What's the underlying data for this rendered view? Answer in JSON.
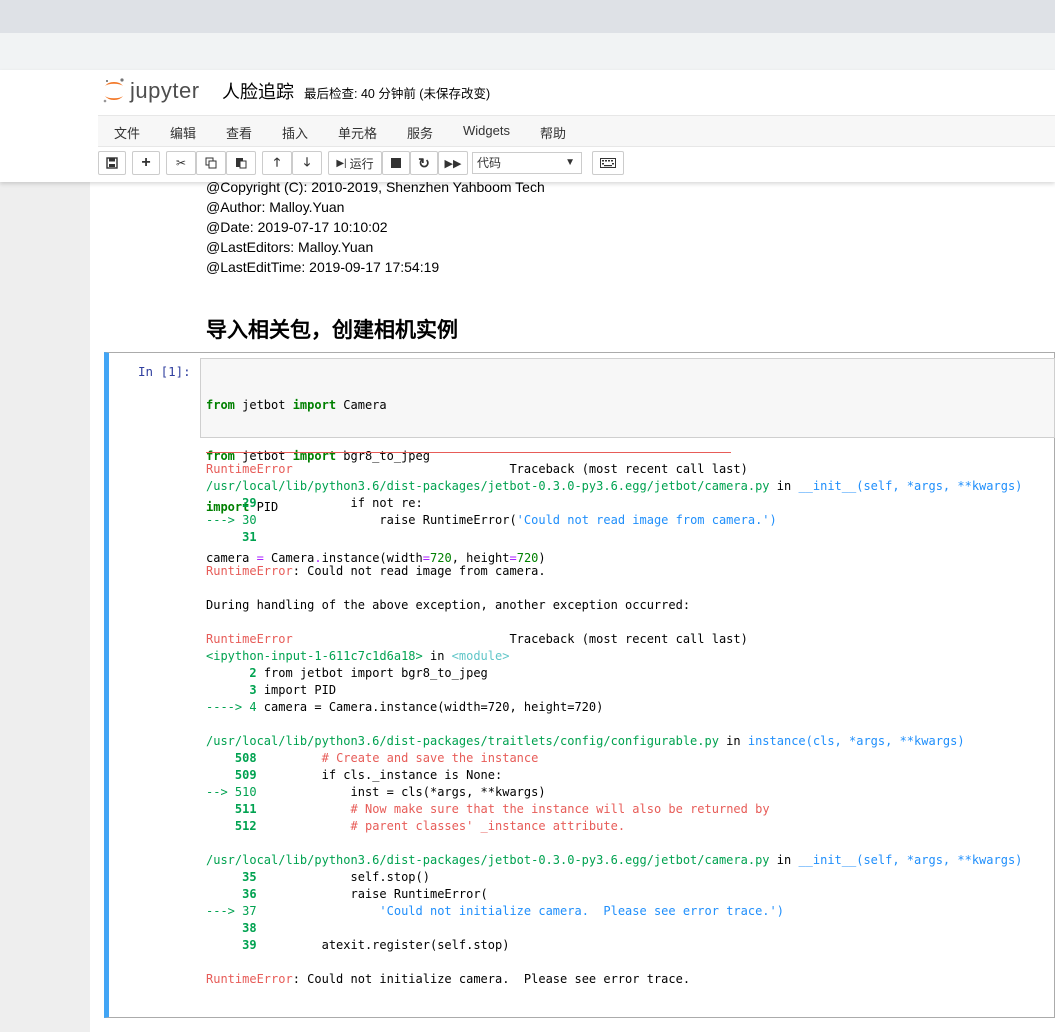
{
  "header": {
    "logo_text": "jupyter",
    "notebook_name": "人脸追踪",
    "checkpoint": "最后检查: 40 分钟前  (未保存改变)"
  },
  "menu": [
    "文件",
    "编辑",
    "查看",
    "插入",
    "单元格",
    "服务",
    "Widgets",
    "帮助"
  ],
  "toolbar": {
    "run_label": "运行",
    "cell_type": "代码"
  },
  "markdown": {
    "lines": [
      "@Copyright (C): 2010-2019, Shenzhen Yahboom Tech",
      "@Author: Malloy.Yuan",
      "@Date: 2019-07-17 10:10:02",
      "@LastEditors: Malloy.Yuan",
      "@LastEditTime: 2019-09-17 17:54:19"
    ],
    "heading": "导入相关包，创建相机实例"
  },
  "cell": {
    "prompt": "In  [1]:",
    "code": [
      "from jetbot import Camera",
      "from jetbot import bgr8_to_jpeg",
      "import PID",
      "camera = Camera.instance(width=720, height=720)"
    ],
    "traceback": [
      "RuntimeError                              Traceback (most recent call last)",
      "/usr/local/lib/python3.6/dist-packages/jetbot-0.3.0-py3.6.egg/jetbot/camera.py in __init__(self, *args, **kwargs)",
      "     29             if not re:",
      "---> 30                 raise RuntimeError('Could not read image from camera.')",
      "     31 ",
      "",
      "RuntimeError: Could not read image from camera.",
      "",
      "During handling of the above exception, another exception occurred:",
      "",
      "RuntimeError                              Traceback (most recent call last)",
      "<ipython-input-1-611c7c1d6a18> in <module>",
      "      2 from jetbot import bgr8_to_jpeg",
      "      3 import PID",
      "----> 4 camera = Camera.instance(width=720, height=720)",
      "",
      "/usr/local/lib/python3.6/dist-packages/traitlets/config/configurable.py in instance(cls, *args, **kwargs)",
      "    508         # Create and save the instance",
      "    509         if cls._instance is None:",
      "--> 510             inst = cls(*args, **kwargs)",
      "    511             # Now make sure that the instance will also be returned by",
      "    512             # parent classes' _instance attribute.",
      "",
      "/usr/local/lib/python3.6/dist-packages/jetbot-0.3.0-py3.6.egg/jetbot/camera.py in __init__(self, *args, **kwargs)",
      "     35             self.stop()",
      "     36             raise RuntimeError(",
      "---> 37                 'Could not initialize camera.  Please see error trace.')",
      "     38 ",
      "     39         atexit.register(self.stop)",
      "",
      "RuntimeError: Could not initialize camera.  Please see error trace."
    ]
  }
}
